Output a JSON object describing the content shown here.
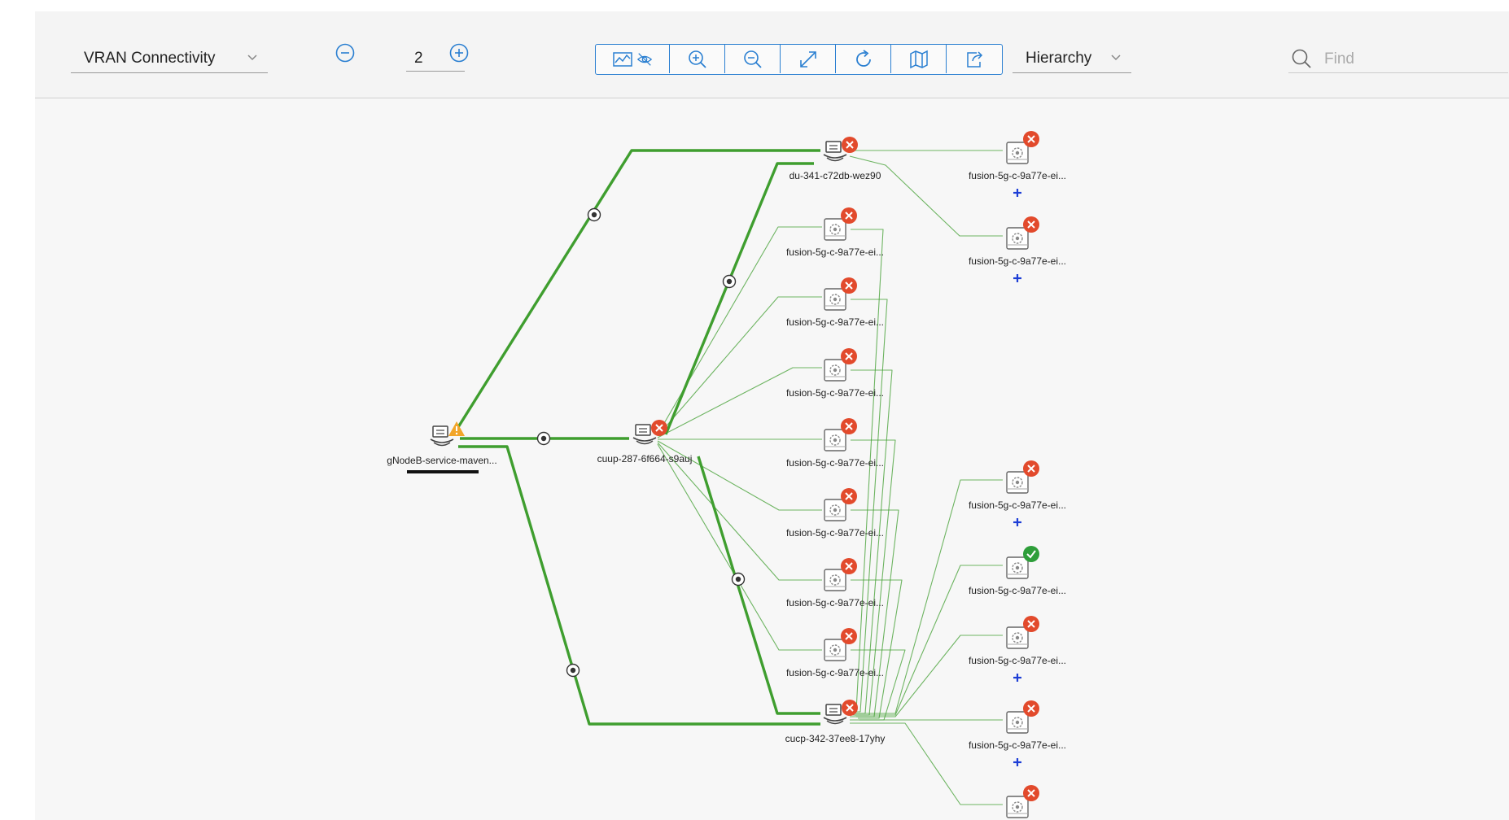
{
  "toolbar": {
    "view_select": "VRAN Connectivity",
    "depth_value": "2",
    "layout_select": "Hierarchy",
    "find_placeholder": "Find"
  },
  "colors": {
    "accent": "#2a7fd1",
    "link_green": "#3f9e2f",
    "error_red": "#e24a2c",
    "warning_orange": "#f2a529",
    "ok_green": "#2e9e3a"
  },
  "nodes": [
    {
      "id": "gnb",
      "label": "gNodeB-service-maven...",
      "type": "service",
      "status": "warning",
      "selected": true
    },
    {
      "id": "cuup",
      "label": "cuup-287-6f664-s9auj",
      "type": "service",
      "status": "error"
    },
    {
      "id": "du",
      "label": "du-341-c72db-wez90",
      "type": "service",
      "status": "error"
    },
    {
      "id": "cucp",
      "label": "cucp-342-37ee8-17yhy",
      "type": "service",
      "status": "error"
    },
    {
      "id": "f1",
      "label": "fusion-5g-c-9a77e-ei...",
      "type": "function",
      "status": "error"
    },
    {
      "id": "f2",
      "label": "fusion-5g-c-9a77e-ei...",
      "type": "function",
      "status": "error"
    },
    {
      "id": "f3",
      "label": "fusion-5g-c-9a77e-ei...",
      "type": "function",
      "status": "error"
    },
    {
      "id": "f4",
      "label": "fusion-5g-c-9a77e-ei...",
      "type": "function",
      "status": "error"
    },
    {
      "id": "f5",
      "label": "fusion-5g-c-9a77e-ei...",
      "type": "function",
      "status": "error"
    },
    {
      "id": "f6",
      "label": "fusion-5g-c-9a77e-ei...",
      "type": "function",
      "status": "error"
    },
    {
      "id": "f7",
      "label": "fusion-5g-c-9a77e-ei...",
      "type": "function",
      "status": "error"
    },
    {
      "id": "du1",
      "label": "fusion-5g-c-9a77e-ei...",
      "type": "function",
      "status": "error",
      "expandable": true
    },
    {
      "id": "du2",
      "label": "fusion-5g-c-9a77e-ei...",
      "type": "function",
      "status": "error",
      "expandable": true
    },
    {
      "id": "c1",
      "label": "fusion-5g-c-9a77e-ei...",
      "type": "function",
      "status": "error",
      "expandable": true
    },
    {
      "id": "c2",
      "label": "fusion-5g-c-9a77e-ei...",
      "type": "function",
      "status": "ok",
      "expandable": false
    },
    {
      "id": "c3",
      "label": "fusion-5g-c-9a77e-ei...",
      "type": "function",
      "status": "error",
      "expandable": true
    },
    {
      "id": "c4",
      "label": "fusion-5g-c-9a77e-ei...",
      "type": "function",
      "status": "error",
      "expandable": true
    },
    {
      "id": "c5",
      "label": "fusion-5g-c-9a77e-ei...",
      "type": "function",
      "status": "error",
      "expandable": false
    }
  ],
  "edges": [
    {
      "from": "gnb",
      "to": "du",
      "thick": true,
      "marker": true
    },
    {
      "from": "gnb",
      "to": "cuup",
      "thick": true,
      "marker": true
    },
    {
      "from": "gnb",
      "to": "cucp",
      "thick": true,
      "marker": true
    },
    {
      "from": "cuup",
      "to": "du",
      "thick": true,
      "marker": true
    },
    {
      "from": "cuup",
      "to": "cucp",
      "thick": true,
      "marker": true
    },
    {
      "from": "cuup",
      "to": "f1"
    },
    {
      "from": "cuup",
      "to": "f2"
    },
    {
      "from": "cuup",
      "to": "f3"
    },
    {
      "from": "cuup",
      "to": "f4"
    },
    {
      "from": "cuup",
      "to": "f5"
    },
    {
      "from": "cuup",
      "to": "f6"
    },
    {
      "from": "cuup",
      "to": "f7"
    },
    {
      "from": "du",
      "to": "du1"
    },
    {
      "from": "du",
      "to": "du2"
    },
    {
      "from": "cucp",
      "to": "c1"
    },
    {
      "from": "cucp",
      "to": "c2"
    },
    {
      "from": "cucp",
      "to": "c3"
    },
    {
      "from": "cucp",
      "to": "c4"
    },
    {
      "from": "cucp",
      "to": "c5"
    },
    {
      "from": "cucp",
      "to": "f1"
    },
    {
      "from": "cucp",
      "to": "f2"
    },
    {
      "from": "cucp",
      "to": "f3"
    },
    {
      "from": "cucp",
      "to": "f4"
    },
    {
      "from": "cucp",
      "to": "f5"
    },
    {
      "from": "cucp",
      "to": "f6"
    },
    {
      "from": "cucp",
      "to": "f7"
    }
  ]
}
